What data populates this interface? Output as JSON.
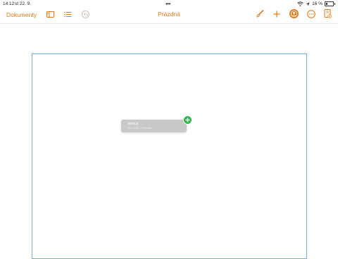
{
  "status_bar": {
    "time": "14:12",
    "date": "st 22. 9.",
    "dots": "•••",
    "battery": "16 %"
  },
  "toolbar": {
    "documents_label": "Dokumenty",
    "title": "Prázdná",
    "accent_color": "#e0791a",
    "icons": {
      "sidebar": "sidebar-icon",
      "list": "list-icon",
      "undo": "undo-icon",
      "format": "paintbrush-icon",
      "insert": "plus-icon",
      "collaborate": "collaborate-icon",
      "more": "more-icon",
      "document_view": "document-view-icon"
    }
  },
  "drag_item": {
    "name": "ARKLE",
    "meta": "22.9.2021 7 minutes",
    "badge_color": "#2fb84a"
  }
}
